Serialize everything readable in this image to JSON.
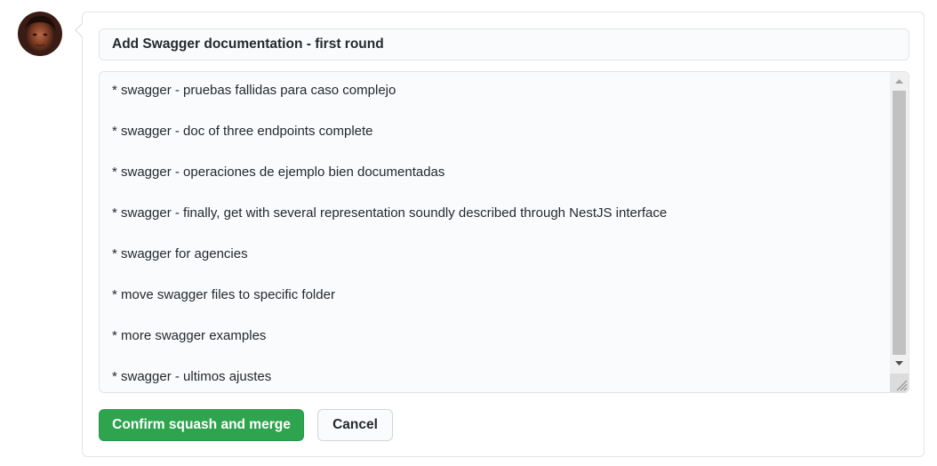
{
  "commit": {
    "title_value": "Add Swagger documentation - first round",
    "body_lines": [
      "* swagger - pruebas fallidas para caso complejo",
      "* swagger - doc of three endpoints complete",
      "* swagger - operaciones de ejemplo bien documentadas",
      "* swagger - finally, get with several representation soundly described through NestJS interface",
      "* swagger for agencies",
      "* move swagger files to specific folder",
      "* more swagger examples",
      "* swagger - ultimos ajustes"
    ]
  },
  "actions": {
    "confirm_label": "Confirm squash and merge",
    "cancel_label": "Cancel"
  },
  "colors": {
    "confirm_bg": "#2ea44f",
    "border": "#e1e4e8",
    "field_bg": "#fafbfc"
  },
  "icons": {
    "avatar": "user-avatar",
    "scroll_up": "scroll-up-arrow-icon",
    "scroll_down": "scroll-down-arrow-icon",
    "resize": "resize-grip-icon"
  }
}
